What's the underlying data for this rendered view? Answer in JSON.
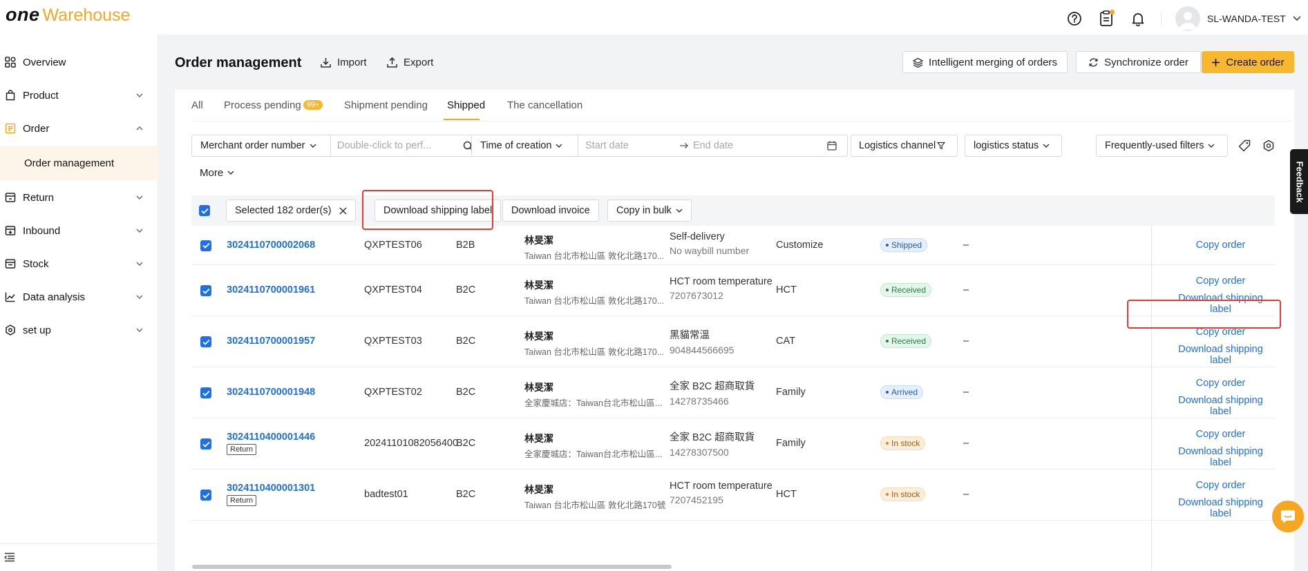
{
  "brand": {
    "one": "one",
    "warehouse": "Warehouse",
    "accent": "#f5a623"
  },
  "user": {
    "name": "SL-WANDA-TEST"
  },
  "sidebar": {
    "items": [
      {
        "label": "Overview",
        "icon": "grid-icon"
      },
      {
        "label": "Product",
        "icon": "bag-icon"
      },
      {
        "label": "Order",
        "icon": "list-icon",
        "expanded": true
      },
      {
        "label": "Return",
        "icon": "return-icon"
      },
      {
        "label": "Inbound",
        "icon": "inbound-icon"
      },
      {
        "label": "Stock",
        "icon": "stock-icon"
      },
      {
        "label": "Data analysis",
        "icon": "chart-icon"
      },
      {
        "label": "set up",
        "icon": "settings-icon"
      }
    ],
    "sub_item": "Order management"
  },
  "header": {
    "title": "Order management",
    "import": "Import",
    "export": "Export",
    "merge": "Intelligent merging of orders",
    "sync": "Synchronize order",
    "create": "Create order"
  },
  "tabs": [
    {
      "label": "All"
    },
    {
      "label": "Process pending",
      "badge": "99+"
    },
    {
      "label": "Shipment pending"
    },
    {
      "label": "Shipped",
      "active": true
    },
    {
      "label": "The cancellation"
    }
  ],
  "filters": {
    "search_field": "Merchant order number",
    "search_placeholder": "Double-click to perf...",
    "time_field": "Time of creation",
    "start_placeholder": "Start date",
    "end_placeholder": "End date",
    "logistics_channel": "Logistics channel",
    "logistics_status": "logistics status",
    "frequent": "Frequently-used filters",
    "more": "More"
  },
  "bulk": {
    "selected": "Selected 182 order(s)",
    "download_label": "Download shipping label",
    "download_invoice": "Download invoice",
    "copy_bulk": "Copy in bulk"
  },
  "rows": [
    {
      "order_no": "3024110700002068",
      "tag": "",
      "merchant": "QXPTEST06",
      "type": "B2B",
      "name": "林旻潔",
      "addr": "Taiwan 台北市松山區 敦化北路170...",
      "channel": "Self-delivery",
      "waybill": "No waybill number",
      "carrier": "Customize",
      "status": "Shipped",
      "status_kind": "blue",
      "dash": "–",
      "ops": [
        "Copy order"
      ]
    },
    {
      "order_no": "3024110700001961",
      "tag": "",
      "merchant": "QXPTEST04",
      "type": "B2C",
      "name": "林旻潔",
      "addr": "Taiwan 台北市松山區 敦化北路170...",
      "channel": "HCT room temperature",
      "waybill": "7207673012",
      "carrier": "HCT",
      "status": "Received",
      "status_kind": "green",
      "dash": "–",
      "ops": [
        "Copy order",
        "Download shipping label"
      ]
    },
    {
      "order_no": "3024110700001957",
      "tag": "",
      "merchant": "QXPTEST03",
      "type": "B2C",
      "name": "林旻潔",
      "addr": "Taiwan 台北市松山區 敦化北路170...",
      "channel": "黑貓常溫",
      "waybill": "904844566695",
      "carrier": "CAT",
      "status": "Received",
      "status_kind": "green",
      "dash": "–",
      "ops": [
        "Copy order",
        "Download shipping label"
      ]
    },
    {
      "order_no": "3024110700001948",
      "tag": "",
      "merchant": "QXPTEST02",
      "type": "B2C",
      "name": "林旻潔",
      "addr": "全家慶城店：Taiwan台北市松山區...",
      "channel": "全家 B2C 超商取貨",
      "waybill": "14278735466",
      "carrier": "Family",
      "status": "Arrived",
      "status_kind": "blue",
      "dash": "–",
      "ops": [
        "Copy order",
        "Download shipping label"
      ]
    },
    {
      "order_no": "3024110400001446",
      "tag": "Return",
      "merchant": "20241101082056400",
      "type": "B2C",
      "name": "林旻潔",
      "addr": "全家慶城店：Taiwan台北市松山區...",
      "channel": "全家 B2C 超商取貨",
      "waybill": "14278307500",
      "carrier": "Family",
      "status": "In stock",
      "status_kind": "orange",
      "dash": "–",
      "ops": [
        "Copy order",
        "Download shipping label"
      ]
    },
    {
      "order_no": "3024110400001301",
      "tag": "Return",
      "merchant": "badtest01",
      "type": "B2C",
      "name": "林旻潔",
      "addr": "Taiwan 台北市松山區 敦化北路170號",
      "channel": "HCT room temperature",
      "waybill": "7207452195",
      "carrier": "HCT",
      "status": "In stock",
      "status_kind": "orange",
      "dash": "–",
      "ops": [
        "Copy order",
        "Download shipping label"
      ]
    }
  ],
  "feedback": "Feedback",
  "colors": {
    "primary": "#1f6fe5",
    "accent": "#f7b731",
    "highlight": "#e53935"
  }
}
